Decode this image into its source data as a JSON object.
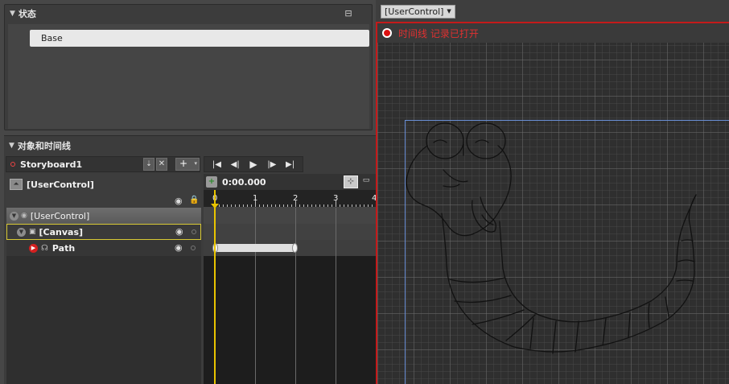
{
  "states_panel": {
    "title": "状态",
    "states": [
      "Base"
    ]
  },
  "objects_panel": {
    "title": "对象和时间线",
    "storyboard_name": "Storyboard1",
    "root_name": "[UserControl]",
    "tree": [
      {
        "label": "[UserControl]"
      },
      {
        "label": "[Canvas]"
      },
      {
        "label": "Path"
      }
    ]
  },
  "timeline": {
    "current_time": "0:00.000",
    "ruler_labels": [
      "0",
      "1",
      "2",
      "3",
      "4"
    ]
  },
  "artboard": {
    "breadcrumb": "[UserControl]",
    "recording_text": "时间线 记录已打开",
    "recording_color": "#e03030",
    "border_color": "#c41a1a"
  },
  "icons": {
    "tri_down": "▼",
    "eye": "◉",
    "lock": "🔒",
    "play": "▶",
    "close": "✕",
    "add": "+",
    "dropdown": "▾"
  }
}
